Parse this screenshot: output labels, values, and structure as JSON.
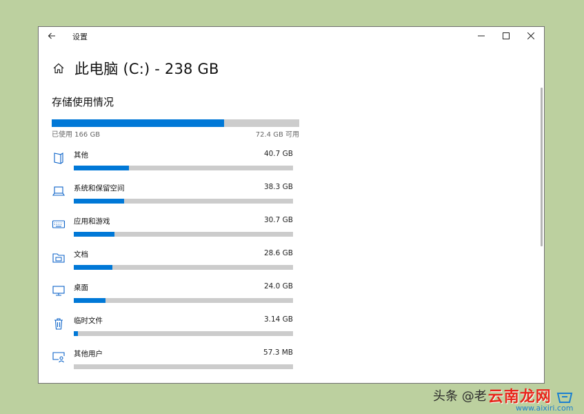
{
  "window": {
    "title": "设置",
    "controls": {
      "minimize": "minimize-icon",
      "maximize": "maximize-icon",
      "close": "close-icon"
    }
  },
  "header": {
    "title": "此电脑 (C:) - 238 GB"
  },
  "storage": {
    "section_title": "存储使用情况",
    "used_label": "已使用 166 GB",
    "free_label": "72.4 GB 可用",
    "used_fraction": 0.697
  },
  "categories": [
    {
      "name": "其他",
      "size": "40.7 GB",
      "fraction": 0.25,
      "icon": "document-icon"
    },
    {
      "name": "系统和保留空间",
      "size": "38.3 GB",
      "fraction": 0.23,
      "icon": "laptop-icon"
    },
    {
      "name": "应用和游戏",
      "size": "30.7 GB",
      "fraction": 0.185,
      "icon": "keyboard-icon"
    },
    {
      "name": "文档",
      "size": "28.6 GB",
      "fraction": 0.175,
      "icon": "folder-icon"
    },
    {
      "name": "桌面",
      "size": "24.0 GB",
      "fraction": 0.145,
      "icon": "monitor-icon"
    },
    {
      "name": "临时文件",
      "size": "3.14 GB",
      "fraction": 0.02,
      "icon": "trash-icon"
    },
    {
      "name": "其他用户",
      "size": "57.3 MB",
      "fraction": 0.0,
      "icon": "user-monitor-icon"
    }
  ],
  "colors": {
    "accent": "#0078d7",
    "track": "#cccccc",
    "background": "#bcd09f"
  },
  "watermark": {
    "prefix": "头条 @老",
    "brand": "云南龙网",
    "url": "www.aixiri.com"
  }
}
